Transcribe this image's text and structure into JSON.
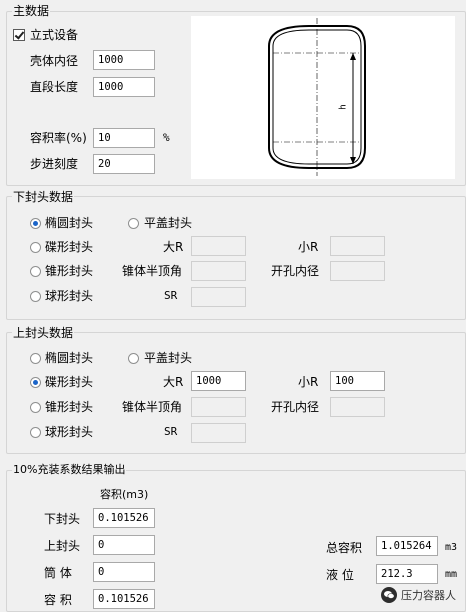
{
  "main": {
    "title": "主数据",
    "vertical_label": "立式设备",
    "vertical_checked": true,
    "shell_id_label": "壳体内径",
    "shell_id_value": "1000",
    "straight_len_label": "直段长度",
    "straight_len_value": "1000",
    "fill_rate_label": "容积率(%)",
    "fill_rate_value": "10",
    "fill_rate_unit": "%",
    "step_label": "步进刻度",
    "step_value": "20",
    "diagram_dim_label": "h"
  },
  "lower_head": {
    "title": "下封头数据",
    "ellip": "椭圆封头",
    "flat": "平盖封头",
    "dished": "碟形封头",
    "conical": "锥形封头",
    "spherical": "球形封头",
    "big_r": "大R",
    "small_r": "小R",
    "half_angle": "锥体半顶角",
    "hole_dia": "开孔内径",
    "sr": "SR",
    "selected": "ellip",
    "big_r_value": "",
    "small_r_value": "",
    "half_angle_value": "",
    "hole_dia_value": "",
    "sr_value": ""
  },
  "upper_head": {
    "title": "上封头数据",
    "ellip": "椭圆封头",
    "flat": "平盖封头",
    "dished": "碟形封头",
    "conical": "锥形封头",
    "spherical": "球形封头",
    "big_r": "大R",
    "small_r": "小R",
    "half_angle": "锥体半顶角",
    "hole_dia": "开孔内径",
    "sr": "SR",
    "selected": "dished",
    "big_r_value": "1000",
    "small_r_value": "100",
    "half_angle_value": "",
    "hole_dia_value": "",
    "sr_value": ""
  },
  "results": {
    "title": "10%充装系数结果输出",
    "volume_header": "容积(m3)",
    "lower_label": "下封头",
    "lower_value": "0.101526",
    "upper_label": "上封头",
    "upper_value": "0",
    "shell_label": "筒 体",
    "shell_value": "0",
    "volume_label": "容 积",
    "volume_value": "0.101526",
    "total_label": "总容积",
    "total_value": "1.015264",
    "total_unit": "m3",
    "level_label": "液 位",
    "level_value": "212.3",
    "level_unit": "mm"
  },
  "watermark": {
    "text": "压力容器人"
  }
}
